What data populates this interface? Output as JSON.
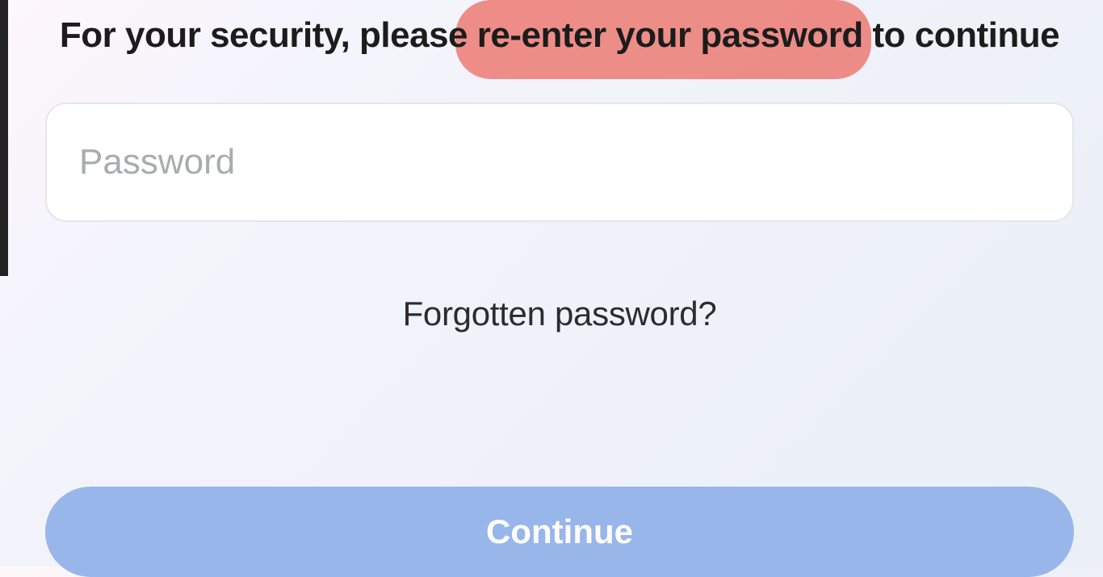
{
  "heading": {
    "text": "For your security, please re-enter your password to continue",
    "highlighted_phrase": "re-enter your password"
  },
  "password": {
    "placeholder": "Password",
    "value": ""
  },
  "links": {
    "forgot_label": "Forgotten password?"
  },
  "buttons": {
    "continue_label": "Continue"
  },
  "colors": {
    "highlight": "#ec7a73",
    "button_bg": "#99b6ea",
    "button_text": "#ffffff"
  }
}
